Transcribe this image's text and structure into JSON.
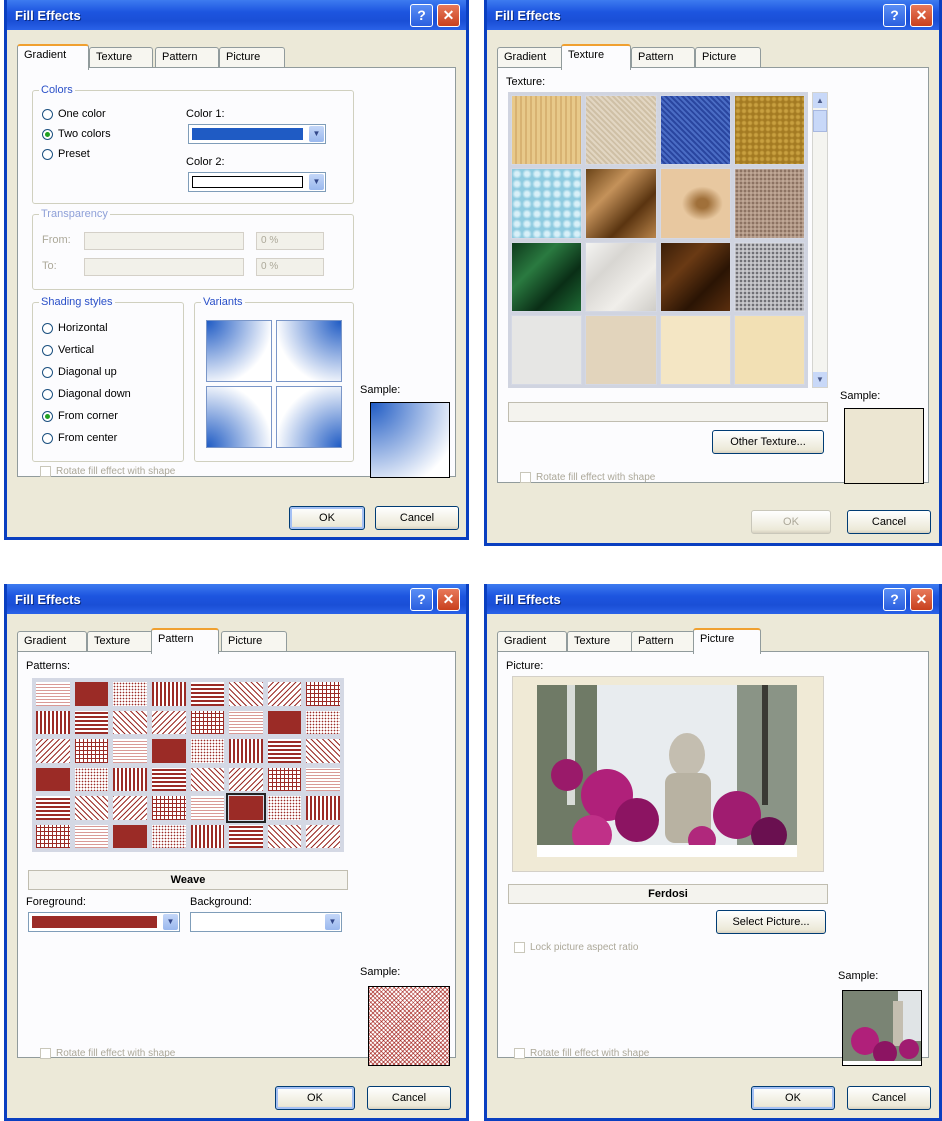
{
  "dialog_title": "Fill Effects",
  "help_glyph": "?",
  "close_glyph": "✕",
  "tabs": [
    "Gradient",
    "Texture",
    "Pattern",
    "Picture"
  ],
  "ok_label": "OK",
  "cancel_label": "Cancel",
  "rotate_label": "Rotate fill effect with shape",
  "sample_label": "Sample:",
  "gradient": {
    "colors_group": "Colors",
    "radios": [
      "One color",
      "Two colors",
      "Preset"
    ],
    "selected_color_radio": "Two colors",
    "color1_label": "Color 1:",
    "color2_label": "Color 2:",
    "color1_value": "#1f5bc4",
    "color2_value": "#ffffff",
    "transparency_group": "Transparency",
    "from_label": "From:",
    "to_label": "To:",
    "from_value": "0 %",
    "to_value": "0 %",
    "shading_group": "Shading styles",
    "shading": [
      "Horizontal",
      "Vertical",
      "Diagonal up",
      "Diagonal down",
      "From corner",
      "From center"
    ],
    "selected_shading": "From corner",
    "variants_group": "Variants"
  },
  "texture": {
    "texture_label": "Texture:",
    "other_texture_button": "Other Texture...",
    "name_value": ""
  },
  "pattern": {
    "patterns_label": "Patterns:",
    "selected_pattern_name": "Weave",
    "foreground_label": "Foreground:",
    "background_label": "Background:",
    "foreground_color": "#9b2b26",
    "background_color": "#ffffff"
  },
  "picture": {
    "picture_label": "Picture:",
    "picture_name": "Ferdosi",
    "select_picture_button": "Select Picture...",
    "lock_aspect_label": "Lock picture aspect ratio"
  }
}
